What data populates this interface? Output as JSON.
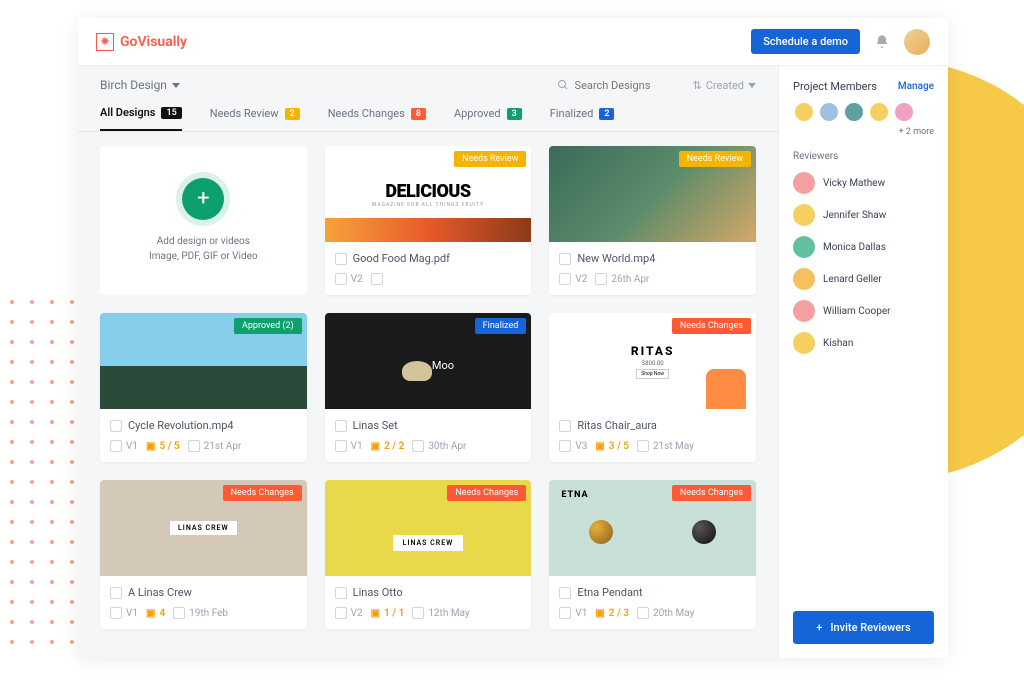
{
  "brand": "GoVisually",
  "topbar": {
    "schedule": "Schedule a demo"
  },
  "project": {
    "name": "Birch Design"
  },
  "search": {
    "placeholder": "Search Designs"
  },
  "sort": {
    "label": "Created"
  },
  "tabs": [
    {
      "label": "All Designs",
      "count": "15",
      "badge": "b-black",
      "active": true
    },
    {
      "label": "Needs Review",
      "count": "2",
      "badge": "b-yellow"
    },
    {
      "label": "Needs Changes",
      "count": "8",
      "badge": "b-orange"
    },
    {
      "label": "Approved",
      "count": "3",
      "badge": "b-green"
    },
    {
      "label": "Finalized",
      "count": "2",
      "badge": "b-blue"
    }
  ],
  "add": {
    "title": "Add design or videos",
    "sub": "Image, PDF, GIF or Video"
  },
  "cards": [
    {
      "title": "Good Food Mag.pdf",
      "status": "Needs Review",
      "scls": "s-yellow",
      "ver": "V2",
      "date": "",
      "thumb": "delicious"
    },
    {
      "title": "New World.mp4",
      "status": "Needs Review",
      "scls": "s-yellow",
      "ver": "V2",
      "date": "26th Apr",
      "thumb": "globe"
    },
    {
      "title": "Cycle Revolution.mp4",
      "status": "Approved (2)",
      "scls": "s-green",
      "ver": "V1",
      "count": "5 / 5",
      "date": "21st Apr",
      "thumb": "cycle"
    },
    {
      "title": "Linas Set",
      "status": "Finalized",
      "scls": "s-blue",
      "ver": "V1",
      "count": "2 / 2",
      "date": "30th Apr",
      "thumb": "linas"
    },
    {
      "title": "Ritas Chair_aura",
      "status": "Needs Changes",
      "scls": "s-orange",
      "ver": "V3",
      "count": "3 / 5",
      "date": "21st May",
      "thumb": "ritas"
    },
    {
      "title": "A Linas Crew",
      "status": "Needs Changes",
      "scls": "s-orange",
      "ver": "V1",
      "count": "4",
      "date": "19th Feb",
      "thumb": "crew"
    },
    {
      "title": "Linas Otto",
      "status": "Needs Changes",
      "scls": "s-orange",
      "ver": "V2",
      "count": "1 / 1",
      "date": "12th May",
      "thumb": "otto"
    },
    {
      "title": "Etna Pendant",
      "status": "Needs Changes",
      "scls": "s-orange",
      "ver": "V1",
      "count": "2 / 3",
      "date": "20th May",
      "thumb": "etna"
    }
  ],
  "sidebar": {
    "title": "Project Members",
    "manage": "Manage",
    "more": "+ 2 more",
    "revhead": "Reviewers",
    "reviewers": [
      {
        "name": "Vicky Mathew",
        "color": "#f5a0a0"
      },
      {
        "name": "Jennifer Shaw",
        "color": "#f5d060"
      },
      {
        "name": "Monica Dallas",
        "color": "#60c0a0"
      },
      {
        "name": "Lenard Geller",
        "color": "#f5c060"
      },
      {
        "name": "William Cooper",
        "color": "#f5a0a0"
      },
      {
        "name": "Kishan",
        "color": "#f5d060"
      }
    ],
    "member_colors": [
      "#f5d060",
      "#a0c0e0",
      "#60a0a0",
      "#f5d060",
      "#f0a0c0"
    ],
    "invite": "Invite Reviewers"
  }
}
